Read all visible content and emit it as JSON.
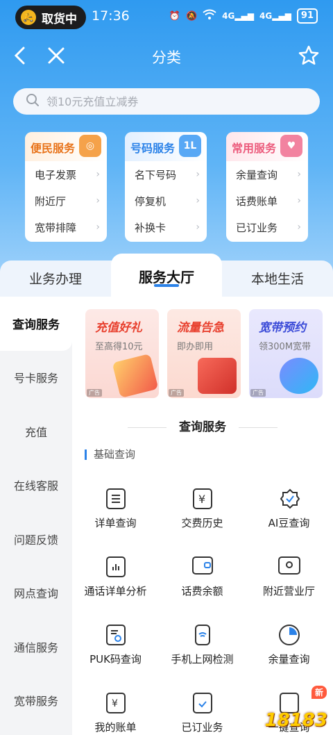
{
  "status_bar": {
    "pickup_label": "取货中",
    "time": "17:36",
    "signal1": "4G",
    "signal2": "4G",
    "battery": "91"
  },
  "header": {
    "title": "分类"
  },
  "search": {
    "placeholder": "领10元充值立减券"
  },
  "cards": [
    {
      "title": "便民服务",
      "items": [
        "电子发票",
        "附近厅",
        "宽带排障"
      ]
    },
    {
      "title": "号码服务",
      "items": [
        "名下号码",
        "停复机",
        "补换卡"
      ]
    },
    {
      "title": "常用服务",
      "items": [
        "余量查询",
        "话费账单",
        "已订业务"
      ]
    }
  ],
  "tabs": [
    "业务办理",
    "服务大厅",
    "本地生活"
  ],
  "sidebar": [
    "查询服务",
    "号卡服务",
    "充值",
    "在线客服",
    "问题反馈",
    "网点查询",
    "通信服务",
    "宽带服务"
  ],
  "banners": [
    {
      "title": "充值好礼",
      "subtitle": "至高得10元",
      "ad": "广告"
    },
    {
      "title": "流量告急",
      "subtitle": "即办即用",
      "ad": "广告"
    },
    {
      "title": "宽带预约",
      "subtitle": "领300M宽带",
      "ad": "广告"
    }
  ],
  "section_title": "查询服务",
  "sub_title": "基础查询",
  "grid_items": [
    {
      "label": "详单查询",
      "icon": "list-doc-icon"
    },
    {
      "label": "交费历史",
      "icon": "yuan-receipt-icon"
    },
    {
      "label": "AI豆查询",
      "icon": "badge-check-icon"
    },
    {
      "label": "通话详单分析",
      "icon": "chart-doc-icon"
    },
    {
      "label": "话费余额",
      "icon": "wallet-icon"
    },
    {
      "label": "附近营业厅",
      "icon": "location-screen-icon"
    },
    {
      "label": "PUK码查询",
      "icon": "doc-search-icon"
    },
    {
      "label": "手机上网检测",
      "icon": "phone-wifi-icon"
    },
    {
      "label": "余量查询",
      "icon": "pie-icon"
    },
    {
      "label": "我的账单",
      "icon": "bill-icon"
    },
    {
      "label": "已订业务",
      "icon": "bag-check-icon"
    },
    {
      "label": "一键查询",
      "icon": "quick-search-icon"
    }
  ],
  "new_badge": "新",
  "watermark": "18183",
  "colors": {
    "primary": "#2b82e8",
    "header_blue": "#2f9af0"
  }
}
